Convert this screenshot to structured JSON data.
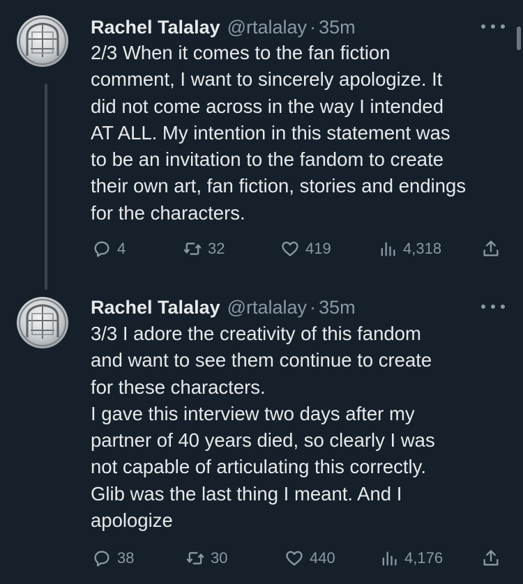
{
  "tweets": [
    {
      "display_name": "Rachel Talalay",
      "handle": "@rtalalay",
      "separator": "·",
      "time": "35m",
      "lines": [
        "2/3 When it comes to the fan fiction",
        "comment, I want to sincerely apologize. It",
        "did not come across in the way I intended",
        "AT ALL. My intention in this statement was",
        "to be an invitation to the fandom to create",
        "their own art, fan fiction, stories and endings",
        "for the characters."
      ],
      "replies": "4",
      "retweets": "32",
      "likes": "419",
      "views": "4,318"
    },
    {
      "display_name": "Rachel Talalay",
      "handle": "@rtalalay",
      "separator": "·",
      "time": "35m",
      "lines": [
        "3/3 I adore the creativity of this fandom",
        "and want to see them continue to create",
        "for these characters.",
        "I gave this interview two days after my",
        "partner of 40 years died, so clearly I was",
        "not capable of articulating this correctly.",
        "Glib was the last thing I meant. And I",
        "apologize"
      ],
      "replies": "38",
      "retweets": "30",
      "likes": "440",
      "views": "4,176"
    }
  ],
  "icons": {
    "reply": "reply-icon",
    "retweet": "retweet-icon",
    "like": "heart-icon",
    "views": "views-icon",
    "share": "share-icon",
    "more": "more-icon"
  },
  "colors": {
    "background": "#15202b",
    "primary_text": "#e7e9ea",
    "secondary_text": "#8b98a5",
    "thread_line": "#38444d"
  }
}
